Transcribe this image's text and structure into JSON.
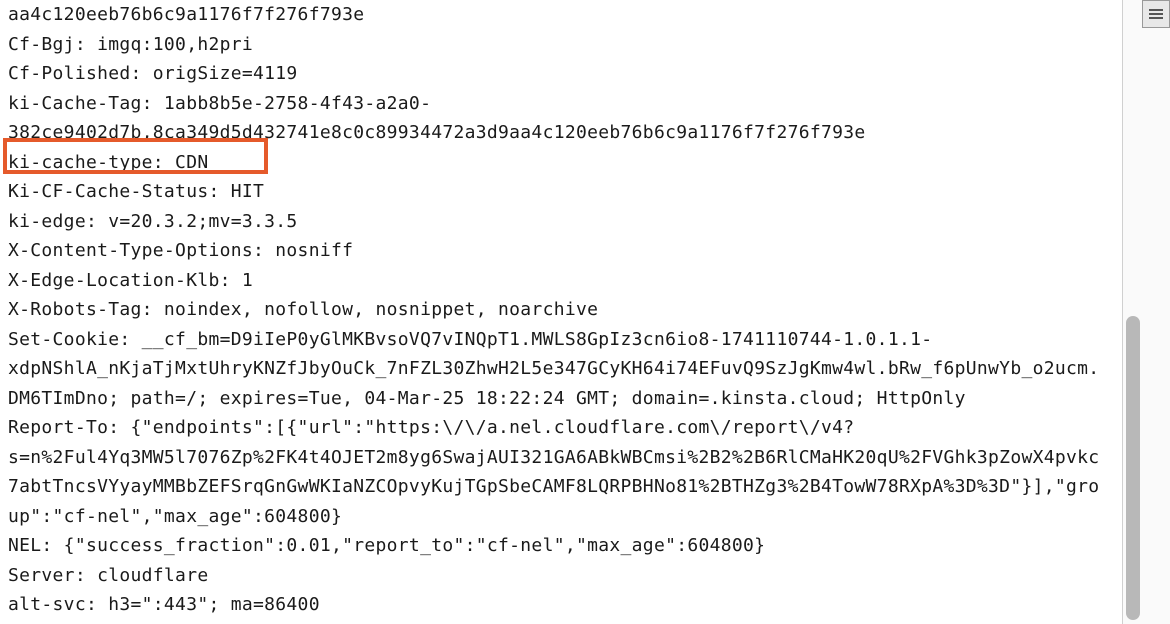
{
  "headers": {
    "line1_hash": "aa4c120eeb76b6c9a1176f7f276f793e",
    "cf_bgj": "Cf-Bgj: imgq:100,h2pri",
    "cf_polished": "Cf-Polished: origSize=4119",
    "ki_cache_tag": "ki-Cache-Tag: 1abb8b5e-2758-4f43-a2a0-382ce9402d7b,8ca349d5d432741e8c0c89934472a3d9aa4c120eeb76b6c9a1176f7f276f793e",
    "ki_cache_type": "ki-cache-type: CDN",
    "ki_cf_cache_status": "Ki-CF-Cache-Status: HIT",
    "ki_edge": "ki-edge: v=20.3.2;mv=3.3.5",
    "x_content_type_options": "X-Content-Type-Options: nosniff",
    "x_edge_location_klb": "X-Edge-Location-Klb: 1",
    "x_robots_tag": "X-Robots-Tag: noindex, nofollow, nosnippet, noarchive",
    "set_cookie": "Set-Cookie: __cf_bm=D9iIeP0yGlMKBvsoVQ7vINQpT1.MWLS8GpIz3cn6io8-1741110744-1.0.1.1-xdpNShlA_nKjaTjMxtUhryKNZfJbyOuCk_7nFZL30ZhwH2L5e347GCyKH64i74EFuvQ9SzJgKmw4wl.bRw_f6pUnwYb_o2ucm.DM6TImDno; path=/; expires=Tue, 04-Mar-25 18:22:24 GMT; domain=.kinsta.cloud; HttpOnly",
    "report_to": "Report-To: {\"endpoints\":[{\"url\":\"https:\\/\\/a.nel.cloudflare.com\\/report\\/v4?s=n%2Ful4Yq3MW5l7076Zp%2FK4t4OJET2m8yg6SwajAUI321GA6ABkWBCmsi%2B2%2B6RlCMaHK20qU%2FVGhk3pZowX4pvkc7abtTncsVYyayMMBbZEFSrqGnGwWKIaNZCOpvyKujTGpSbeCAMF8LQRPBHNo81%2BTHZg3%2B4TowW78RXpA%3D%3D\"}],\"group\":\"cf-nel\",\"max_age\":604800}",
    "nel": "NEL: {\"success_fraction\":0.01,\"report_to\":\"cf-nel\",\"max_age\":604800}",
    "server": "Server: cloudflare",
    "alt_svc": "alt-svc: h3=\":443\"; ma=86400"
  }
}
